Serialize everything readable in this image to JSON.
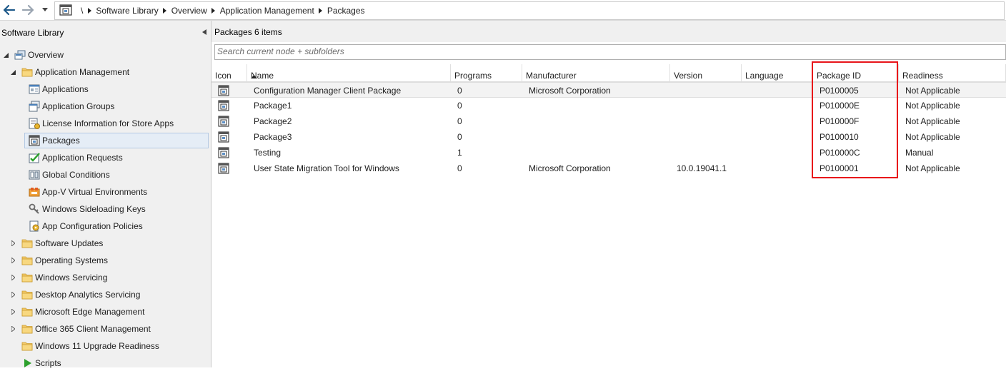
{
  "breadcrumb": [
    "\\",
    "Software Library",
    "Overview",
    "Application Management",
    "Packages"
  ],
  "sidebar": {
    "title": "Software Library",
    "items": [
      {
        "label": "Overview",
        "icon": "overview-icon"
      },
      {
        "label": "Application Management",
        "icon": "folder-icon"
      },
      {
        "label": "Applications",
        "icon": "applications-icon"
      },
      {
        "label": "Application Groups",
        "icon": "application-groups-icon"
      },
      {
        "label": "License Information for Store Apps",
        "icon": "license-icon"
      },
      {
        "label": "Packages",
        "icon": "package-icon"
      },
      {
        "label": "Application Requests",
        "icon": "requests-icon"
      },
      {
        "label": "Global Conditions",
        "icon": "conditions-icon"
      },
      {
        "label": "App-V Virtual Environments",
        "icon": "appv-icon"
      },
      {
        "label": "Windows Sideloading Keys",
        "icon": "keys-icon"
      },
      {
        "label": "App Configuration Policies",
        "icon": "policy-icon"
      },
      {
        "label": "Software Updates",
        "icon": "folder-icon"
      },
      {
        "label": "Operating Systems",
        "icon": "folder-icon"
      },
      {
        "label": "Windows Servicing",
        "icon": "folder-icon"
      },
      {
        "label": "Desktop Analytics Servicing",
        "icon": "folder-icon"
      },
      {
        "label": "Microsoft Edge Management",
        "icon": "folder-icon"
      },
      {
        "label": "Office 365 Client Management",
        "icon": "folder-icon"
      },
      {
        "label": "Windows 11 Upgrade Readiness",
        "icon": "folder-icon"
      },
      {
        "label": "Scripts",
        "icon": "scripts-icon"
      }
    ]
  },
  "main": {
    "title": "Packages 6 items",
    "search_placeholder": "Search current node + subfolders",
    "columns": [
      "Icon",
      "Name",
      "Programs",
      "Manufacturer",
      "Version",
      "Language",
      "Package ID",
      "Readiness"
    ],
    "rows": [
      {
        "name": "Configuration Manager Client Package",
        "programs": "0",
        "manufacturer": "Microsoft Corporation",
        "version": "",
        "language": "",
        "package_id": "P0100005",
        "readiness": "Not Applicable"
      },
      {
        "name": "Package1",
        "programs": "0",
        "manufacturer": "",
        "version": "",
        "language": "",
        "package_id": "P010000E",
        "readiness": "Not Applicable"
      },
      {
        "name": "Package2",
        "programs": "0",
        "manufacturer": "",
        "version": "",
        "language": "",
        "package_id": "P010000F",
        "readiness": "Not Applicable"
      },
      {
        "name": "Package3",
        "programs": "0",
        "manufacturer": "",
        "version": "",
        "language": "",
        "package_id": "P0100010",
        "readiness": "Not Applicable"
      },
      {
        "name": "Testing",
        "programs": "1",
        "manufacturer": "",
        "version": "",
        "language": "",
        "package_id": "P010000C",
        "readiness": "Manual"
      },
      {
        "name": "User State Migration Tool for Windows",
        "programs": "0",
        "manufacturer": "Microsoft Corporation",
        "version": "10.0.19041.1",
        "language": "",
        "package_id": "P0100001",
        "readiness": "Not Applicable"
      }
    ]
  },
  "colors": {
    "highlight": "#e8141a",
    "selection": "#e5edf6",
    "folder": "#f3c969"
  }
}
